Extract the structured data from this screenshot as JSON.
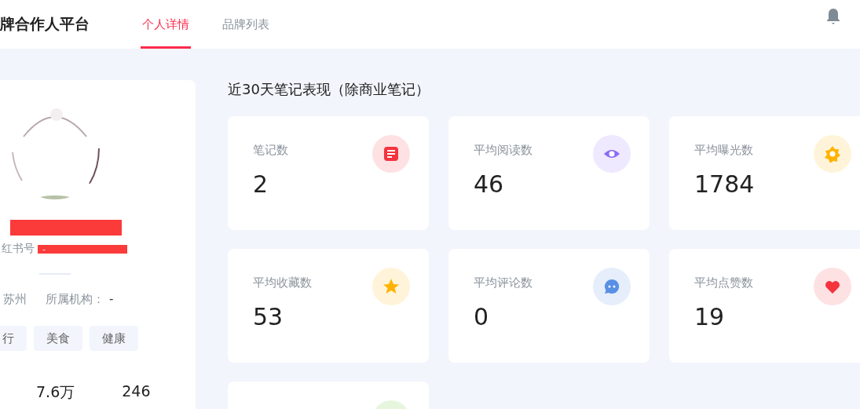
{
  "header": {
    "brand": "牌合作人平台",
    "tabs": [
      {
        "label": "个人详情",
        "selected": true
      },
      {
        "label": "品牌列表",
        "selected": false
      }
    ]
  },
  "profile": {
    "avatar": {
      "kind": "picture"
    },
    "name_redacted": true,
    "id_label": "红书号",
    "id_value": "-",
    "id_redacted": true,
    "location": "苏州",
    "org_label": "所属机构：",
    "org_value": "-",
    "tags": [
      "行",
      "美食",
      "健康"
    ],
    "stats": [
      "7.6万",
      "246"
    ]
  },
  "section": {
    "title": "近30天笔记表现（除商业笔记）",
    "metrics": [
      {
        "label": "笔记数",
        "value": "2",
        "kind": "note",
        "color": "#f5333f"
      },
      {
        "label": "平均阅读数",
        "value": "46",
        "kind": "eye",
        "color": "#8c6cf5"
      },
      {
        "label": "平均曝光数",
        "value": "1784",
        "kind": "sun",
        "color": "#ffb300"
      },
      {
        "label": "平均收藏数",
        "value": "53",
        "kind": "star",
        "color": "#ffb300"
      },
      {
        "label": "平均评论数",
        "value": "0",
        "kind": "chat",
        "color": "#5a8fe6"
      },
      {
        "label": "平均点赞数",
        "value": "19",
        "kind": "heart",
        "color": "#f5333f"
      },
      {
        "kind": "blank",
        "color": "#e6f6de"
      }
    ]
  }
}
